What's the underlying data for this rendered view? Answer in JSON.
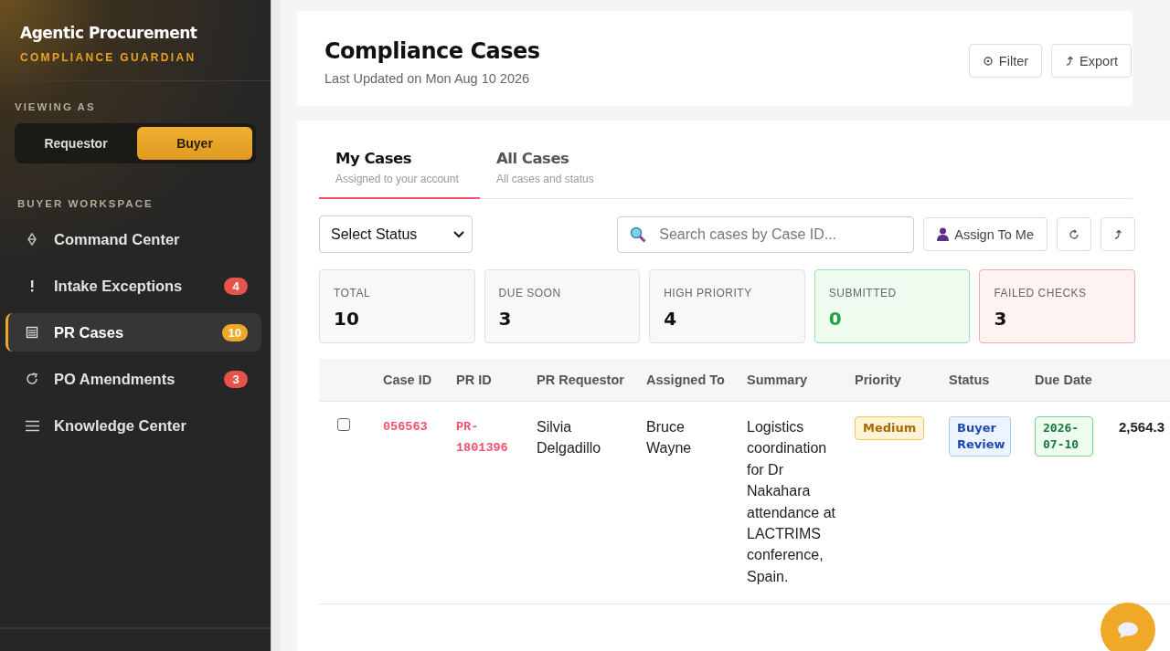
{
  "sidebar": {
    "brand": "Agentic Procurement",
    "tagline": "COMPLIANCE GUARDIAN",
    "viewing_as_label": "VIEWING AS",
    "roles": [
      {
        "label": "Requestor",
        "selected": false
      },
      {
        "label": "Buyer",
        "selected": true
      }
    ],
    "section_label": "BUYER WORKSPACE",
    "nav": [
      {
        "label": "Command Center",
        "selected": false
      },
      {
        "label": "Intake Exceptions",
        "badge": "4",
        "color": "#e5534b",
        "selected": false
      },
      {
        "label": "PR Cases",
        "badge": "10",
        "color": "#f0a828",
        "selected": true
      },
      {
        "label": "PO Amendments",
        "badge": "3",
        "color": "#e5534b",
        "selected": false
      },
      {
        "label": "Knowledge Center",
        "selected": false
      }
    ]
  },
  "header": {
    "title": "Compliance Cases",
    "subtitle": "Last Updated on Mon Aug 10 2026",
    "buttons": [
      "Filter",
      "Export"
    ]
  },
  "tabs": [
    {
      "title": "My Cases",
      "subtitle": "Assigned to your account",
      "selected": true
    },
    {
      "title": "All Cases",
      "subtitle": "All cases and status",
      "selected": false
    }
  ],
  "toolbar": {
    "status_select": "Select Status",
    "search_placeholder": "Search cases by Case ID...",
    "assign_button": "Assign To Me"
  },
  "stats": [
    {
      "label": "TOTAL",
      "value": "10",
      "kind": "neutral"
    },
    {
      "label": "DUE SOON",
      "value": "3",
      "kind": "neutral"
    },
    {
      "label": "HIGH PRIORITY",
      "value": "4",
      "kind": "neutral"
    },
    {
      "label": "SUBMITTED",
      "value": "0",
      "kind": "success"
    },
    {
      "label": "FAILED CHECKS",
      "value": "3",
      "kind": "danger"
    }
  ],
  "table": {
    "columns": [
      "Case ID",
      "PR ID",
      "PR Requestor",
      "Assigned To",
      "Summary",
      "Priority",
      "Status",
      "Due Date"
    ],
    "rows": [
      {
        "checked": false,
        "case_id": "056563",
        "pr_id": "PR-1801396",
        "requestor": "Silvia Delgadillo",
        "assigned_to": "Bruce Wayne",
        "summary": "Logistics coordination for Dr Nakahara attendance at LACTRIMS conference, Spain.",
        "priority": {
          "label": "Medium",
          "kind": "medium"
        },
        "status": "Buyer Review",
        "due_date": "2026-07-10",
        "column_9": "2,564.3"
      }
    ]
  }
}
